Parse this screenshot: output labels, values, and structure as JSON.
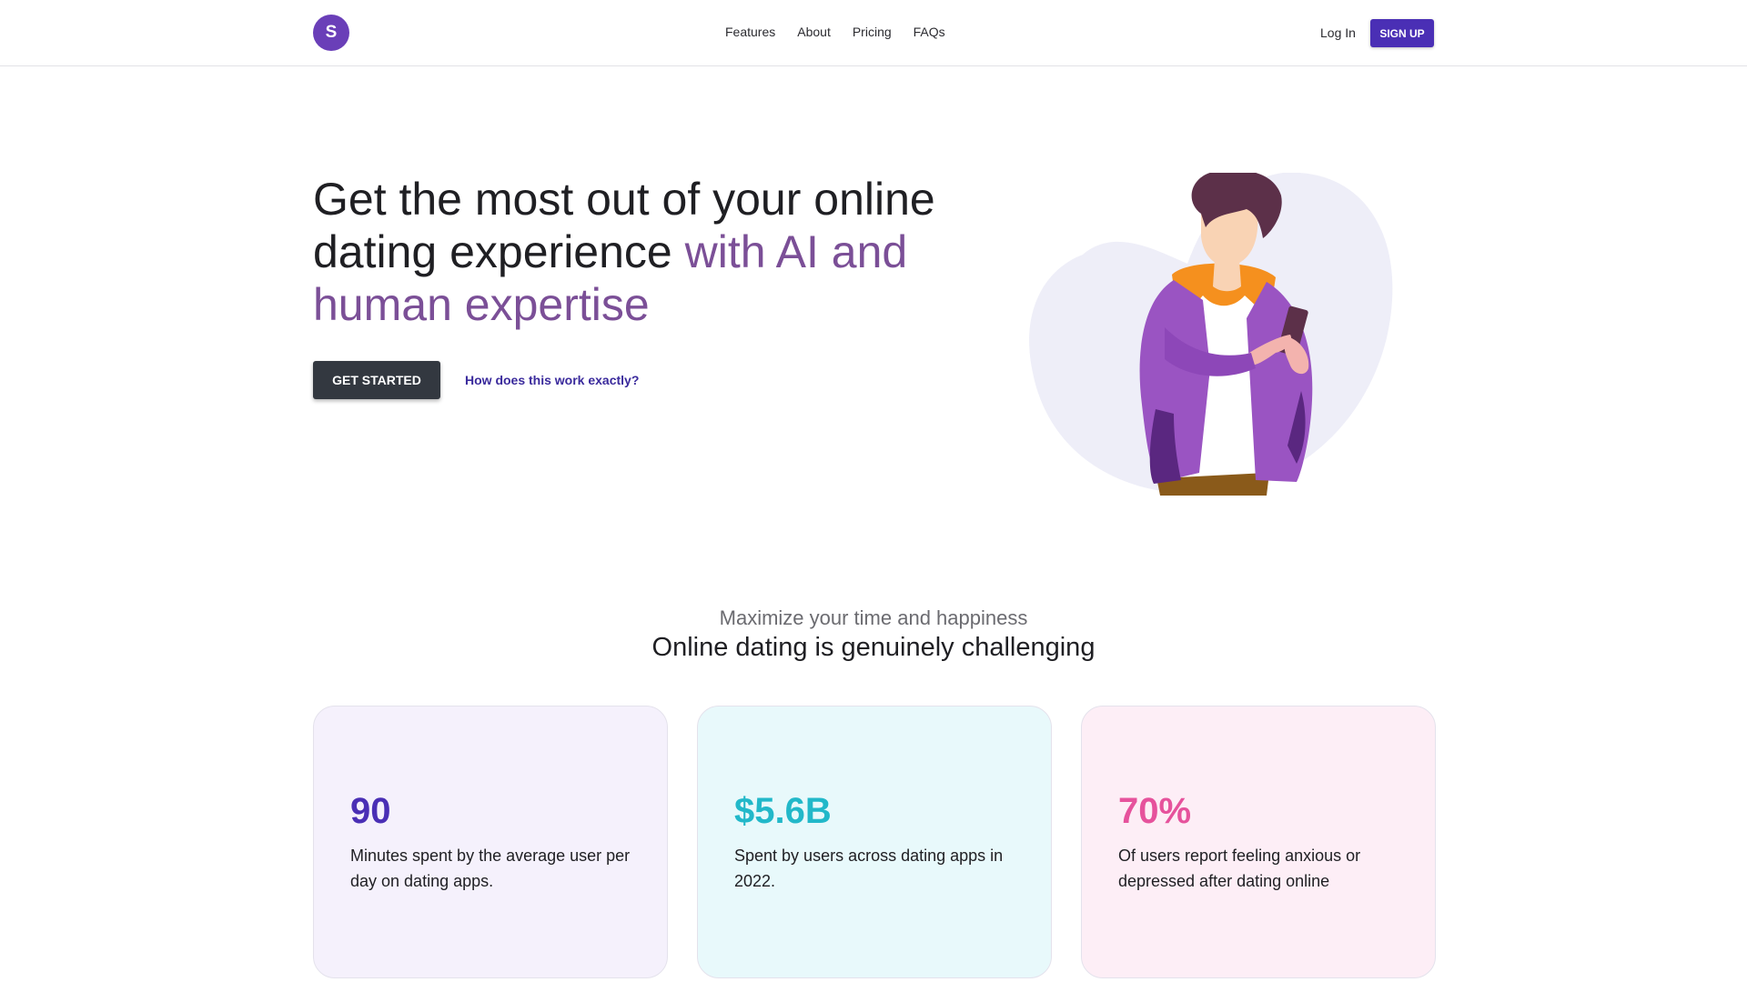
{
  "nav": {
    "logo_letter": "S",
    "links": [
      "Features",
      "About",
      "Pricing",
      "FAQs"
    ],
    "login_label": "Log In",
    "signup_label": "SIGN UP"
  },
  "hero": {
    "title_plain": "Get the most out of your online dating experience ",
    "title_accent": "with AI and human expertise",
    "cta_label": "GET STARTED",
    "secondary_link": "How does this work exactly?"
  },
  "stats_section": {
    "subtitle": "Maximize your time and happiness",
    "title": "Online dating is genuinely challenging",
    "cards": [
      {
        "value": "90",
        "description": "Minutes spent by the average user per day on dating apps.",
        "color": "#4a2fb5"
      },
      {
        "value": "$5.6B",
        "description": "Spent by users across dating apps in 2022.",
        "color": "#22b8c9"
      },
      {
        "value": "70%",
        "description": "Of users report feeling anxious or depressed after dating online",
        "color": "#e6529c"
      }
    ]
  },
  "colors": {
    "brand_purple": "#6a3fb8",
    "signup_button": "#4a2fb5",
    "hero_accent": "#7b4f97",
    "cta_dark": "#333840"
  },
  "icons": {
    "logo": "logo-badge",
    "illustration": "man-with-phone-illustration"
  }
}
